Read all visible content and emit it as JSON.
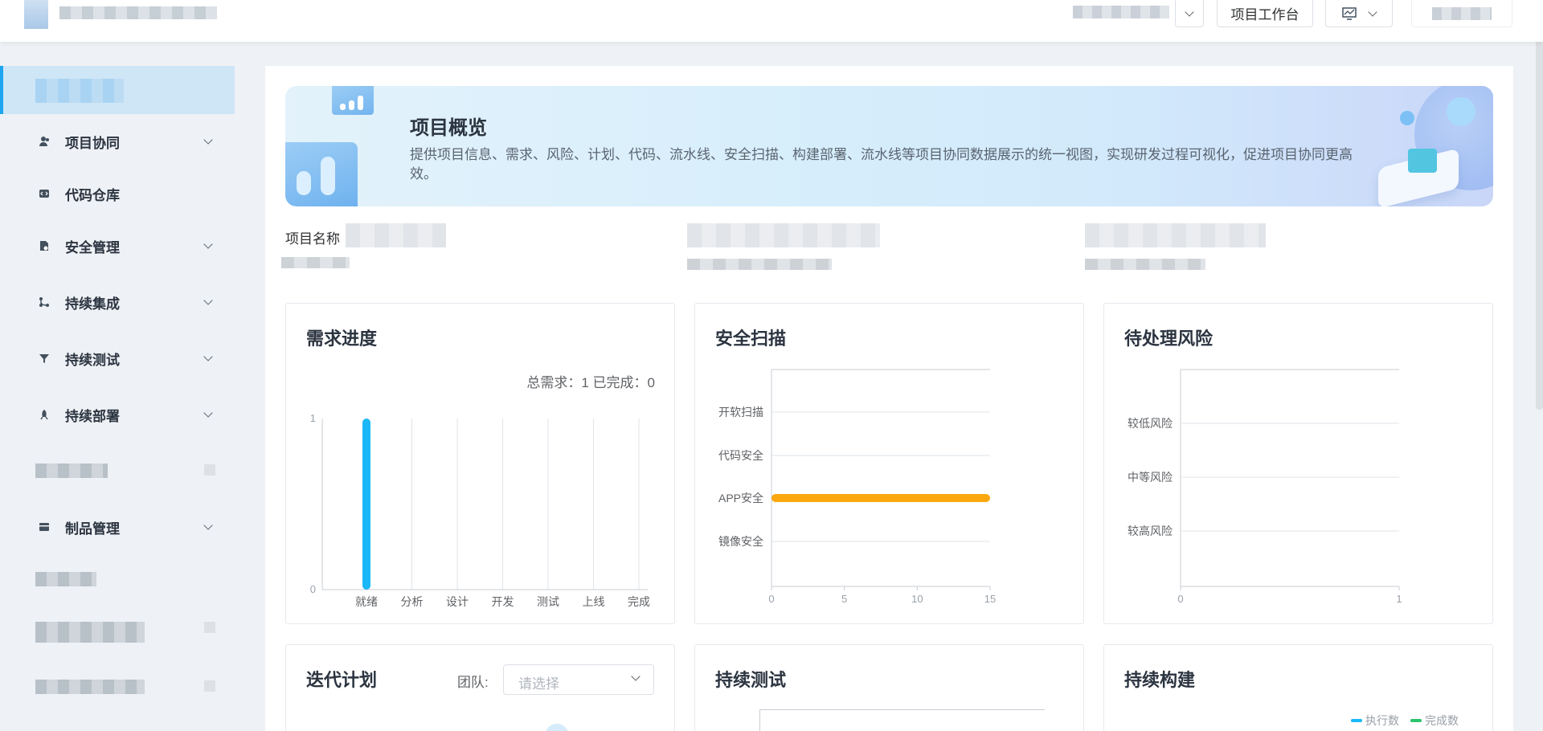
{
  "header": {
    "workbench_label": "项目工作台"
  },
  "sidebar": {
    "items": [
      {
        "label": "项目协同",
        "icon": "team-icon",
        "expandable": true
      },
      {
        "label": "代码仓库",
        "icon": "code-repo-icon",
        "expandable": false
      },
      {
        "label": "安全管理",
        "icon": "security-doc-icon",
        "expandable": true
      },
      {
        "label": "持续集成",
        "icon": "branch-icon",
        "expandable": true
      },
      {
        "label": "持续测试",
        "icon": "funnel-icon",
        "expandable": true
      },
      {
        "label": "持续部署",
        "icon": "rocket-icon",
        "expandable": true
      },
      {
        "label": "制品管理",
        "icon": "package-icon",
        "expandable": true
      }
    ]
  },
  "banner": {
    "title": "项目概览",
    "description": "提供项目信息、需求、风险、计划、代码、流水线、安全扫描、构建部署、流水线等项目协同数据展示的统一视图，实现研发过程可视化，促进项目协同更高效。"
  },
  "project_info": {
    "name_label": "项目名称"
  },
  "cards": {
    "demand": {
      "title": "需求进度",
      "summary": "总需求：1 已完成：0"
    },
    "security": {
      "title": "安全扫描"
    },
    "risk": {
      "title": "待处理风险"
    },
    "iteration": {
      "title": "迭代计划",
      "team_label": "团队:",
      "team_placeholder": "请选择"
    },
    "testing": {
      "title": "持续测试"
    },
    "build": {
      "title": "持续构建",
      "legend": [
        "执行数",
        "完成数"
      ]
    }
  },
  "colors": {
    "accent": "#1ea5f0",
    "bar_blue": "#1ab8f7",
    "bar_orange": "#fba70e",
    "legend_green": "#2bc46a"
  },
  "chart_data": [
    {
      "type": "bar",
      "title": "需求进度",
      "categories": [
        "就绪",
        "分析",
        "设计",
        "开发",
        "测试",
        "上线",
        "完成"
      ],
      "values": [
        1,
        0,
        0,
        0,
        0,
        0,
        0
      ],
      "ylim": [
        0,
        1
      ],
      "yticks": [
        "0",
        "1"
      ]
    },
    {
      "type": "bar",
      "orientation": "horizontal",
      "title": "安全扫描",
      "categories": [
        "开软扫描",
        "代码安全",
        "APP安全",
        "镜像安全"
      ],
      "values": [
        0,
        0,
        15,
        0
      ],
      "xlim": [
        0,
        15
      ],
      "xticks": [
        "0",
        "5",
        "10",
        "15"
      ]
    },
    {
      "type": "bar",
      "orientation": "horizontal",
      "title": "待处理风险",
      "categories": [
        "较低风险",
        "中等风险",
        "较高风险"
      ],
      "values": [
        0,
        0,
        0
      ],
      "xlim": [
        0,
        1
      ],
      "xticks": [
        "0",
        "1"
      ]
    }
  ]
}
